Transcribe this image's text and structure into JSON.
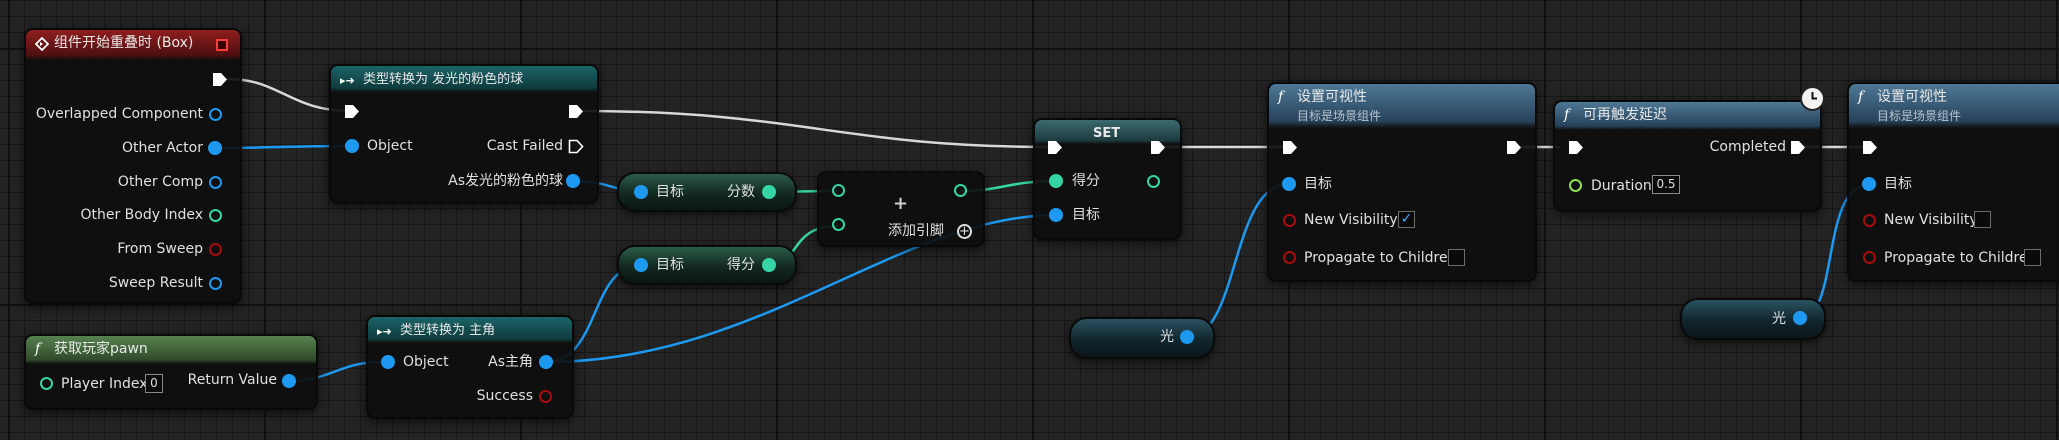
{
  "colors": {
    "object_pin": "#1d99f1",
    "struct_pin": "#1d99f1",
    "int_pin": "#36d5a5",
    "float_pin": "#8ee050",
    "bool_pin": "#a50d0d",
    "event_header": "#8f1e1e",
    "cast_header": "#1b6468",
    "function_header": "#4e7896",
    "pure_header": "#56824f"
  },
  "event_node": {
    "title": "组件开始重叠时 (Box)",
    "pins": [
      "Overlapped Component",
      "Other Actor",
      "Other Comp",
      "Other Body Index",
      "From Sweep",
      "Sweep Result"
    ]
  },
  "cast_ball": {
    "title": "类型转换为 发光的粉色的球",
    "object_label": "Object",
    "cast_failed_label": "Cast Failed",
    "as_label": "As发光的粉色的球"
  },
  "get_score": {
    "target_label": "目标",
    "output_label": "分数"
  },
  "get_points": {
    "target_label": "目标",
    "output_label": "得分"
  },
  "add_node": {
    "symbol": "+",
    "add_pin_label": "添加引脚"
  },
  "set_node": {
    "title": "SET",
    "value_label": "得分",
    "target_label": "目标"
  },
  "get_player_pawn": {
    "title": "获取玩家pawn",
    "player_index_label": "Player Index",
    "player_index_value": "0",
    "return_label": "Return Value"
  },
  "cast_hero": {
    "title": "类型转换为 主角",
    "object_label": "Object",
    "as_label": "As主角",
    "success_label": "Success"
  },
  "light_var_1": {
    "label": "光"
  },
  "light_var_2": {
    "label": "光"
  },
  "set_visibility_1": {
    "title": "设置可视性",
    "subtitle": "目标是场景组件",
    "target_label": "目标",
    "new_visibility_label": "New Visibility",
    "new_visibility_checked": true,
    "propagate_label": "Propagate to Children",
    "propagate_checked": false
  },
  "retriggerable_delay": {
    "title": "可再触发延迟",
    "completed_label": "Completed",
    "duration_label": "Duration",
    "duration_value": "0.5"
  },
  "set_visibility_2": {
    "title": "设置可视性",
    "subtitle": "目标是场景组件",
    "target_label": "目标",
    "new_visibility_label": "New Visibility",
    "new_visibility_checked": false,
    "propagate_label": "Propagate to Children",
    "propagate_checked": false
  }
}
